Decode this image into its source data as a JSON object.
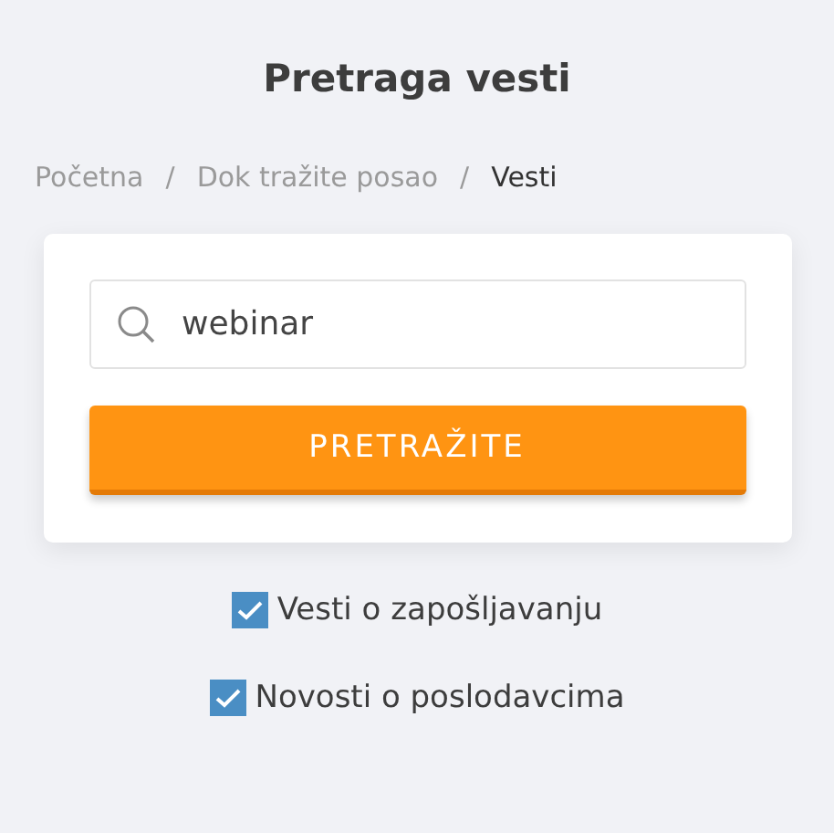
{
  "title": "Pretraga vesti",
  "breadcrumb": [
    {
      "kind": "link",
      "label": "Početna"
    },
    {
      "kind": "separator",
      "label": "/"
    },
    {
      "kind": "link",
      "label": "Dok tražite posao"
    },
    {
      "kind": "separator",
      "label": "/"
    },
    {
      "kind": "current",
      "label": "Vesti"
    }
  ],
  "search": {
    "value": "webinar"
  },
  "button": "PRETRAŽITE",
  "filters": [
    {
      "label": "Vesti o zapošljavanju",
      "checked": true
    },
    {
      "label": "Novosti o poslodavcima",
      "checked": true
    }
  ]
}
